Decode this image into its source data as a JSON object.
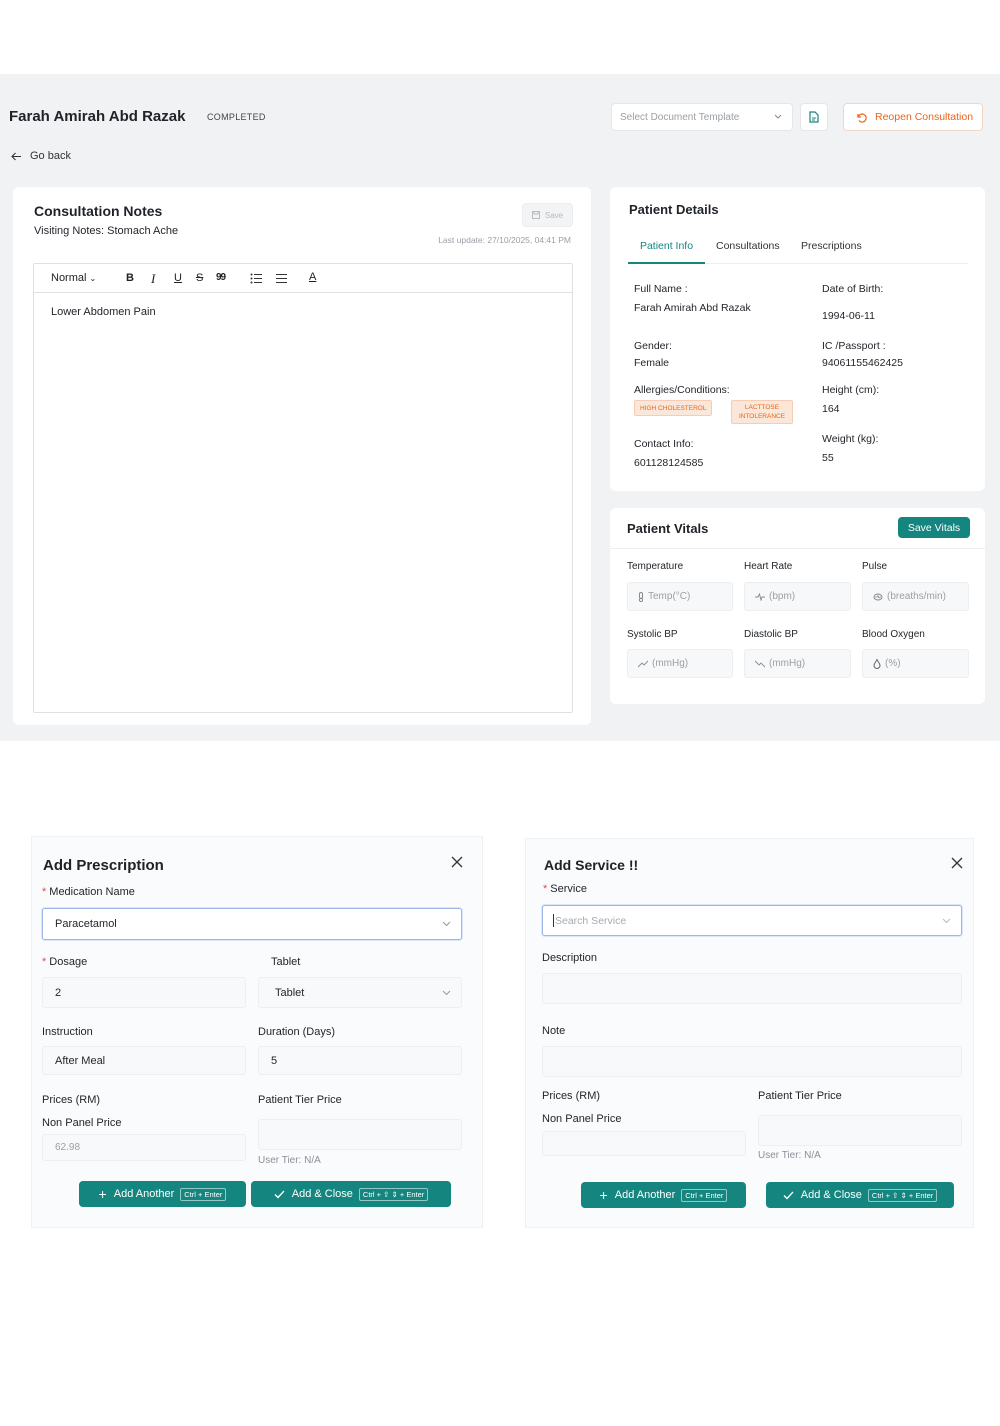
{
  "header": {
    "patient_name": "Farah Amirah Abd Razak",
    "status": "COMPLETED",
    "template_placeholder": "Select Document Template",
    "reopen_label": "Reopen Consultation",
    "go_back": "Go back"
  },
  "notes": {
    "title": "Consultation Notes",
    "visiting_notes": "Visiting Notes: Stomach Ache",
    "save_label": "Save",
    "last_update": "Last update: 27/10/2025, 04:41 PM",
    "toolbar": {
      "style": "Normal",
      "bold": "B",
      "italic": "I",
      "underline": "U",
      "strike": "S",
      "quote": "99",
      "color": "A"
    },
    "content": "Lower Abdomen Pain"
  },
  "patient_details": {
    "title": "Patient Details",
    "tabs": [
      "Patient Info",
      "Consultations",
      "Prescriptions"
    ],
    "full_name_label": "Full Name :",
    "full_name": "Farah Amirah Abd Razak",
    "dob_label": "Date of Birth:",
    "dob": "1994-06-11",
    "gender_label": "Gender:",
    "gender": "Female",
    "ic_label": "IC /Passport :",
    "ic": "94061155462425",
    "allergies_label": "Allergies/Conditions:",
    "allergies": [
      "HIGH CHOLESTEROL",
      "LACTTOSE INTOLERANCE"
    ],
    "height_label": "Height (cm):",
    "height": "164",
    "contact_label": "Contact Info:",
    "contact": "601128124585",
    "weight_label": "Weight (kg):",
    "weight": "55"
  },
  "vitals": {
    "title": "Patient Vitals",
    "save_label": "Save Vitals",
    "temperature_label": "Temperature",
    "temperature_placeholder": "Temp(°C)",
    "heart_rate_label": "Heart Rate",
    "heart_rate_placeholder": "(bpm)",
    "pulse_label": "Pulse",
    "pulse_placeholder": "(breaths/min)",
    "systolic_label": "Systolic BP",
    "systolic_placeholder": "(mmHg)",
    "diastolic_label": "Diastolic BP",
    "diastolic_placeholder": "(mmHg)",
    "oxygen_label": "Blood Oxygen",
    "oxygen_placeholder": "(%)"
  },
  "prescription": {
    "title": "Add Prescription",
    "medication_label": "Medication Name",
    "medication_value": "Paracetamol",
    "dosage_label": "Dosage",
    "dosage_value": "2",
    "unit_label": "Tablet",
    "unit_value": "Tablet",
    "instruction_label": "Instruction",
    "instruction_value": "After Meal",
    "duration_label": "Duration (Days)",
    "duration_value": "5",
    "prices_label": "Prices (RM)",
    "tier_price_label": "Patient Tier Price",
    "non_panel_label": "Non Panel Price",
    "non_panel_value": "62.98",
    "user_tier": "User Tier: N/A",
    "add_another": "Add Another",
    "add_another_kbd": "Ctrl + Enter",
    "add_close": "Add & Close",
    "add_close_kbd": "Ctrl + ⇧ ⇕ + Enter"
  },
  "service": {
    "title": "Add Service !!",
    "service_label": "Service",
    "service_placeholder": "Search Service",
    "description_label": "Description",
    "note_label": "Note",
    "prices_label": "Prices (RM)",
    "tier_price_label": "Patient Tier Price",
    "non_panel_label": "Non Panel Price",
    "user_tier": "User Tier: N/A",
    "add_another": "Add Another",
    "add_another_kbd": "Ctrl + Enter",
    "add_close": "Add & Close",
    "add_close_kbd": "Ctrl + ⇧ ⇕ + Enter"
  },
  "colors": {
    "accent": "#15857f",
    "warning": "#e8651a",
    "tag_bg": "#fbe7da"
  }
}
